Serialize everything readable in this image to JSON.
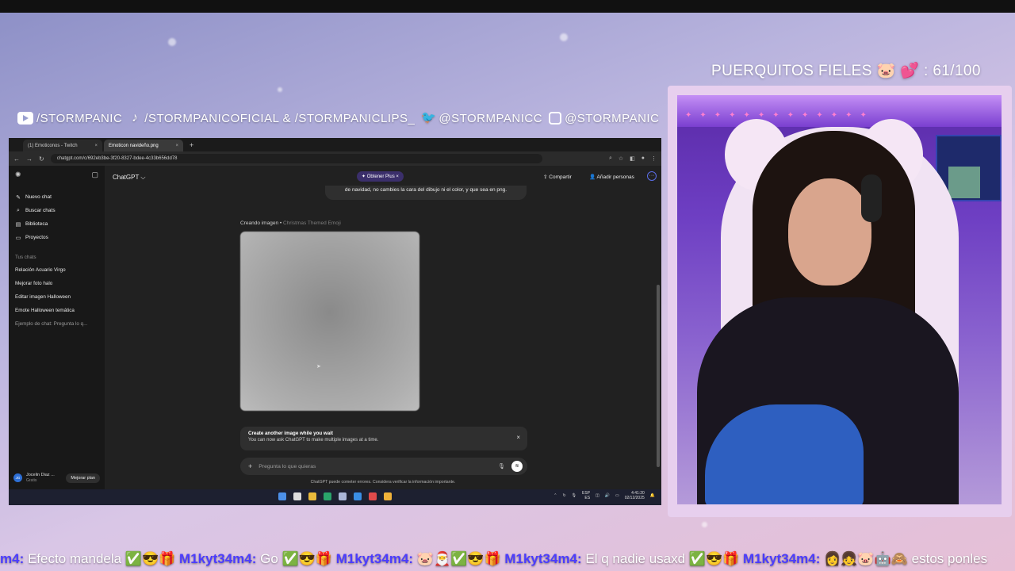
{
  "overlay": {
    "socials": [
      {
        "icon": "youtube-icon",
        "text": "/STORMPANIC"
      },
      {
        "icon": "tiktok-icon",
        "text": "/STORMPANICOFICIAL & /STORMPANICLIPS_"
      },
      {
        "icon": "twitter-icon",
        "text": "@STORMPANICC"
      },
      {
        "icon": "instagram-icon",
        "text": "@STORMPANIC"
      }
    ],
    "counter": {
      "label": "PUERQUITOS FIELES 🐷 💕 : 61/100",
      "value": 61,
      "goal": 100
    }
  },
  "browser": {
    "tabs": [
      {
        "label": "(1) Emoticonos - Twitch",
        "close": "×"
      },
      {
        "label": "Emoticon navideño.png",
        "close": "×"
      }
    ],
    "new_tab": "+",
    "url": "chatgpt.com/c/692eb3be-3f20-8327-bdee-4c33b656dd78"
  },
  "chatgpt": {
    "sidebar": {
      "items": [
        {
          "icon": "edit-icon",
          "label": "Nuevo chat"
        },
        {
          "icon": "search-icon",
          "label": "Buscar chats"
        },
        {
          "icon": "library-icon",
          "label": "Biblioteca"
        },
        {
          "icon": "folder-icon",
          "label": "Proyectos"
        }
      ],
      "section_title": "Tus chats",
      "chats": [
        "Relación Acuario Virgo",
        "Mejorar foto halo",
        "Editar imagen Halloween",
        "Emote Halloween temática",
        "Ejemplo de chat: Pregunta lo q..."
      ],
      "user": {
        "initials": "JG",
        "name": "Jocelin Diaz ...",
        "plan": "Gratis",
        "upgrade": "Mejorar plan"
      }
    },
    "header": {
      "model": "ChatGPT ⌵",
      "plus": "✦ Obtener Plus ×",
      "share": "Compartir",
      "add_people": "Añadir personas",
      "more": "···"
    },
    "user_message": "de navidad, no cambies la cara del dibujo ni el color, y que sea en png.",
    "creating": {
      "prefix": "Creando imagen • ",
      "title": "Christmas Themed Emoji"
    },
    "toast": {
      "title": "Create another image while you wait",
      "body": "You can now ask ChatGPT to make multiple images at a time.",
      "close": "×"
    },
    "composer": {
      "placeholder": "Pregunta lo que quieras",
      "plus": "+"
    },
    "disclaimer": "ChatGPT puede cometer errores. Considera verificar la información importante."
  },
  "taskbar": {
    "lang": "ESP\nES",
    "time": "4:41:20",
    "date": "02/12/2025"
  },
  "ticker": [
    {
      "user": "m4:",
      "msg": " Efecto mandela ✅😎🎁 "
    },
    {
      "user": "M1kyt34m4:",
      "msg": " Go ✅😎🎁 "
    },
    {
      "user": "M1kyt34m4:",
      "msg": " 🐷🎅✅😎🎁 "
    },
    {
      "user": "M1kyt34m4:",
      "msg": " El q nadie usaxd ✅😎🎁 "
    },
    {
      "user": "M1kyt34m4:",
      "msg": " 👩👧🐷🤖🙈 estos ponles"
    }
  ]
}
